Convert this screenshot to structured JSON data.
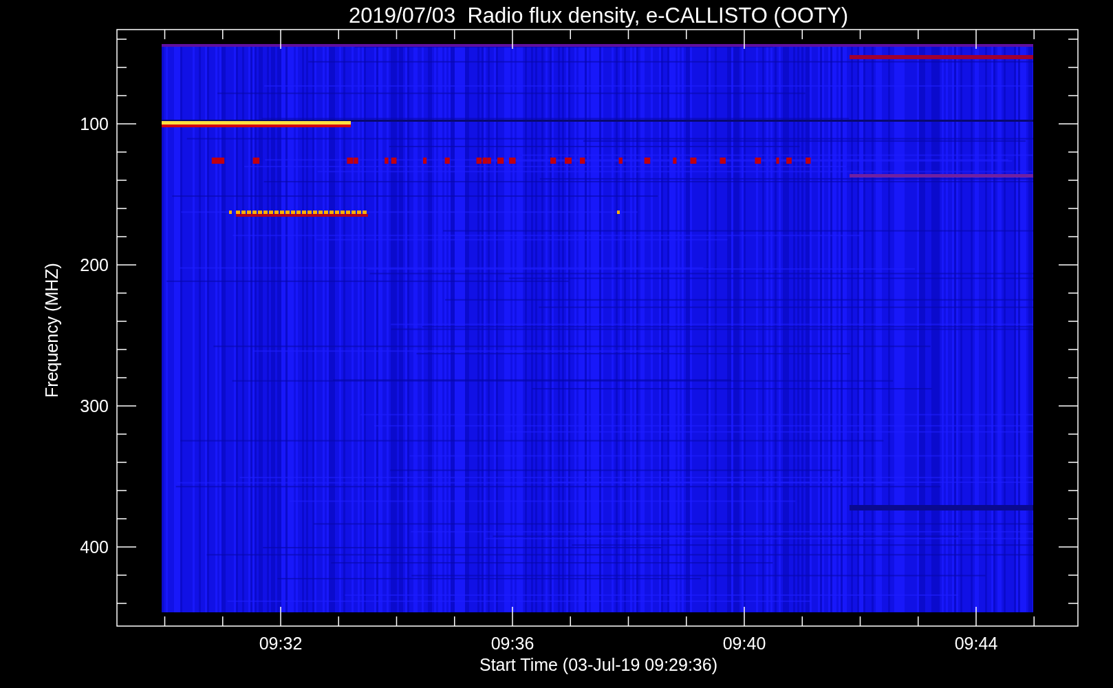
{
  "title": "2019/07/03  Radio flux density, e-CALLISTO (OOTY)",
  "y_axis": {
    "label": "Frequency (MHZ)",
    "ticks": [
      "100",
      "200",
      "300",
      "400"
    ]
  },
  "x_axis": {
    "label": "Start Time (03-Jul-19 09:29:36)",
    "ticks": [
      "09:32",
      "09:36",
      "09:40",
      "09:44"
    ]
  }
}
